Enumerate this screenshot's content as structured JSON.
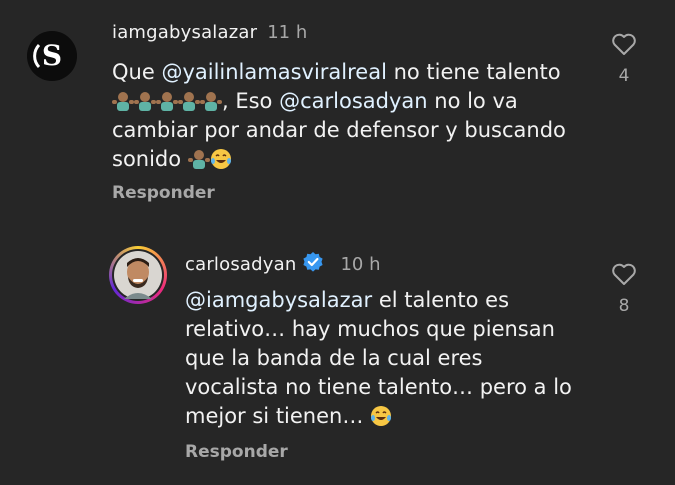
{
  "comments": [
    {
      "username": "iamgabysalazar",
      "time": "11 h",
      "text_1": "Que ",
      "mention_1": "@yailinlamasviralreal",
      "text_2": " no tiene talento",
      "text_3": ", Eso ",
      "mention_2": "@carlosadyan",
      "text_4": " no lo va",
      "text_5": "cambiar por andar de defensor y buscando",
      "text_6": "sonido ",
      "reply_label": "Responder",
      "likes": "4",
      "avatar_letter": "S"
    },
    {
      "username": "carlosadyan",
      "time": "10 h",
      "mention_1": "@iamgabysalazar",
      "text_1": " el talento es",
      "text_2": "relativo… hay muchos que piensan",
      "text_3": "que la banda de la cual eres",
      "text_4": "vocalista no tiene talento… pero a lo",
      "text_5": "mejor si tienen… ",
      "reply_label": "Responder",
      "likes": "8"
    }
  ],
  "colors": {
    "background": "#262626",
    "text": "#f2f2f2",
    "muted": "#a8a8a8",
    "mention": "#e0f1ff",
    "verified": "#3797f0"
  }
}
